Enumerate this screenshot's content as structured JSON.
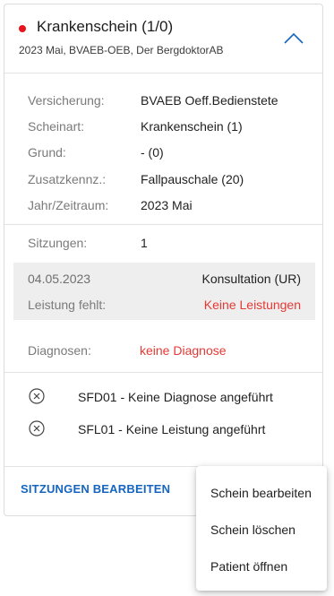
{
  "card": {
    "title": "Krankenschein (1/0)",
    "subtitle": "2023 Mai, BVAEB-OEB, Der BergdoktorAB",
    "status_color": "#e8131d",
    "accent_color": "#1565c0",
    "expand_icon": "chevron-up-icon"
  },
  "details": [
    {
      "label": "Versicherung:",
      "value": "BVAEB Oeff.Bedienstete"
    },
    {
      "label": "Scheinart:",
      "value": "Krankenschein (1)"
    },
    {
      "label": "Grund:",
      "value": "- (0)"
    },
    {
      "label": "Zusatzkennz.:",
      "value": "Fallpauschale (20)"
    },
    {
      "label": "Jahr/Zeitraum:",
      "value": "2023 Mai"
    }
  ],
  "sessions": {
    "label": "Sitzungen:",
    "count": "1",
    "items": [
      {
        "date": "04.05.2023",
        "type": "Konsultation (UR)",
        "missing_label": "Leistung fehlt:",
        "missing_value": "Keine Leistungen"
      }
    ]
  },
  "diagnoses": {
    "label": "Diagnosen:",
    "value": "keine Diagnose"
  },
  "warnings": [
    {
      "icon": "close-circle-icon",
      "text": "SFD01 - Keine Diagnose angeführt"
    },
    {
      "icon": "close-circle-icon",
      "text": "SFL01 - Keine Leistung angeführt"
    }
  ],
  "actions": {
    "edit_sessions": "SITZUNGEN BEARBEITEN"
  },
  "context_menu": {
    "items": [
      "Schein bearbeiten",
      "Schein löschen",
      "Patient öffnen"
    ]
  }
}
